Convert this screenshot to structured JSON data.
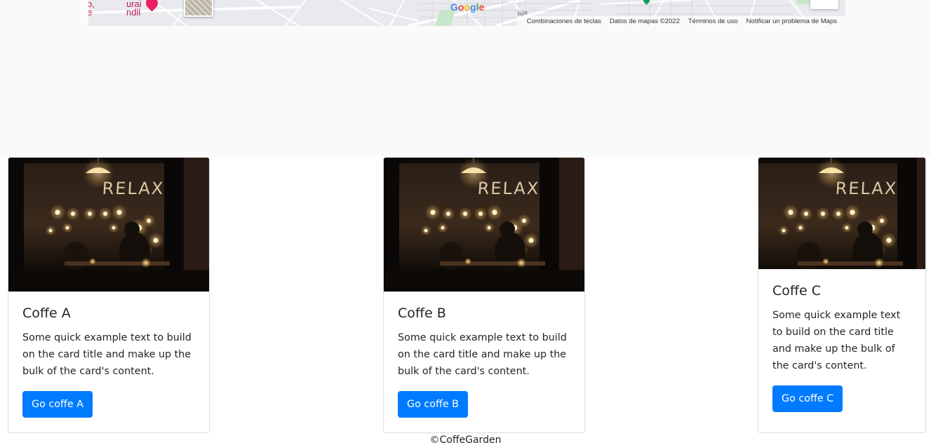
{
  "map": {
    "poi_left": "o,\ne",
    "poi_name": "urai\nndil",
    "street_label": "hile",
    "google_letters": [
      {
        "ch": "G",
        "color": "#4285F4"
      },
      {
        "ch": "o",
        "color": "#EA4335"
      },
      {
        "ch": "o",
        "color": "#FBBC05"
      },
      {
        "ch": "g",
        "color": "#4285F4"
      },
      {
        "ch": "l",
        "color": "#34A853"
      },
      {
        "ch": "e",
        "color": "#EA4335"
      }
    ],
    "attribution": {
      "shortcuts": "Combinaciones de teclas",
      "data": "Datos de mapas ©2022",
      "terms": "Términos de uso",
      "report": "Notificar un problema de Maps"
    }
  },
  "cards": [
    {
      "title": "Coffe A",
      "text": "Some quick example text to build on the card title and make up the bulk of the card's content.",
      "button": "Go coffe A",
      "image_sign": "RELAX"
    },
    {
      "title": "Coffe B",
      "text": "Some quick example text to build on the card title and make up the bulk of the card's content.",
      "button": "Go coffe B",
      "image_sign": "RELAX"
    },
    {
      "title": "Coffe C",
      "text": "Some quick example text to build on the card title and make up the bulk of the card's content.",
      "button": "Go coffe C",
      "image_sign": "RELAX"
    }
  ],
  "footer": {
    "text": "©CoffeGarden"
  },
  "colors": {
    "primary": "#007bff",
    "page_band": "#fafafa",
    "map_bg": "#e8eaed"
  }
}
